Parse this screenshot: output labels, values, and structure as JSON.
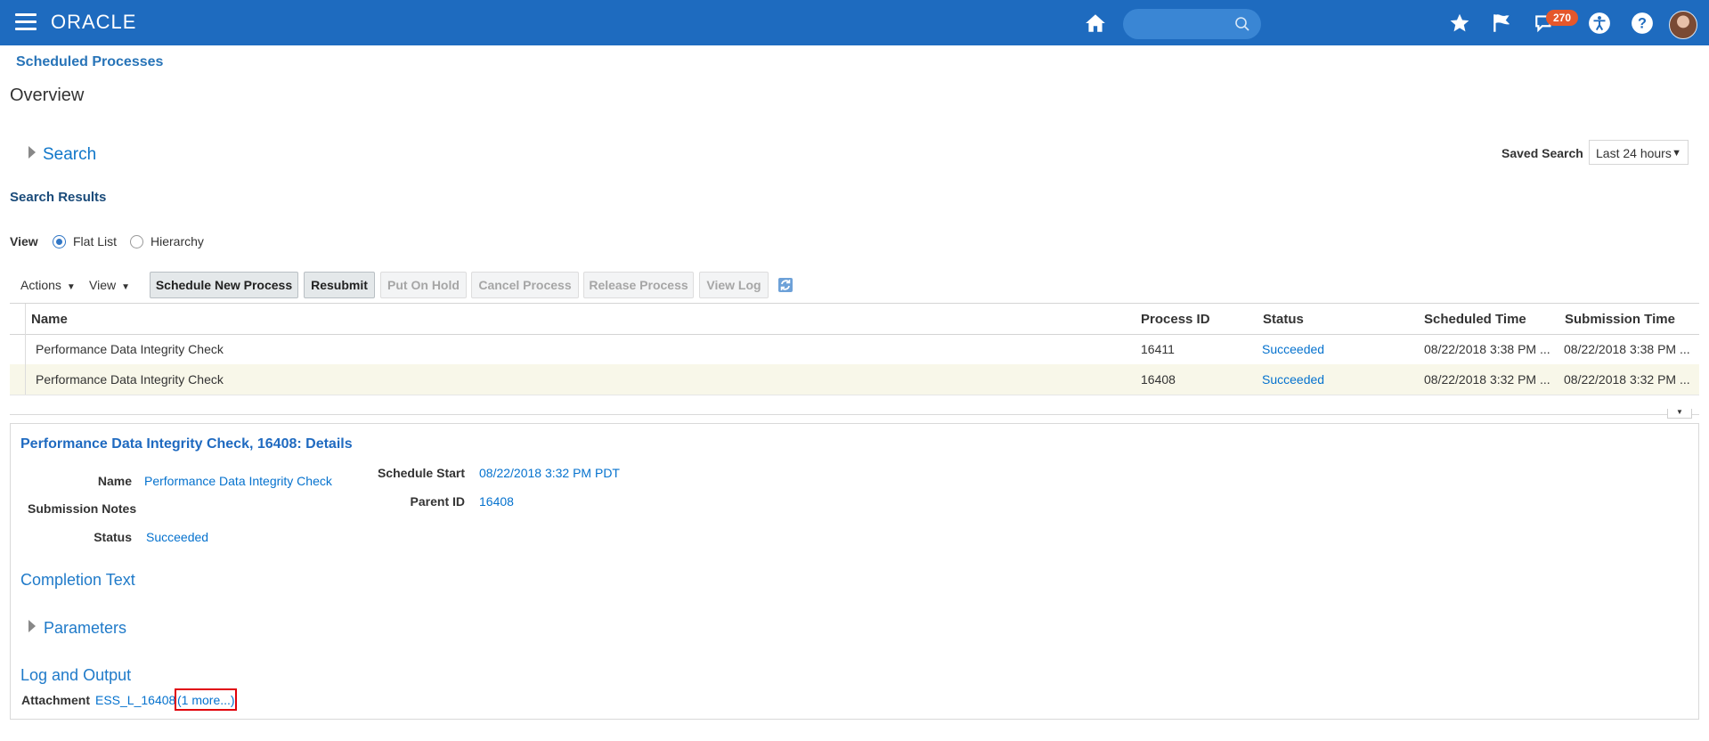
{
  "header": {
    "logo_text": "ORACLE",
    "notification_count": "270",
    "icons": [
      "menu-icon",
      "home-icon",
      "search-icon",
      "star-icon",
      "flag-icon",
      "notification-icon",
      "accessibility-icon",
      "help-icon",
      "avatar"
    ],
    "colors": {
      "bar": "#1e6bbf",
      "badge": "#e5572b"
    }
  },
  "breadcrumb": "Scheduled Processes",
  "page_title": "Overview",
  "search_section": {
    "label": "Search",
    "saved_search_label": "Saved Search",
    "saved_search_value": "Last 24 hours"
  },
  "results": {
    "title": "Search Results",
    "view_label": "View",
    "view_options": [
      {
        "label": "Flat List",
        "checked": true
      },
      {
        "label": "Hierarchy",
        "checked": false
      }
    ],
    "toolbar": {
      "actions_menu": "Actions",
      "view_menu": "View",
      "buttons": [
        {
          "label": "Schedule New Process",
          "enabled": true
        },
        {
          "label": "Resubmit",
          "enabled": true
        },
        {
          "label": "Put On Hold",
          "enabled": false
        },
        {
          "label": "Cancel Process",
          "enabled": false
        },
        {
          "label": "Release Process",
          "enabled": false
        },
        {
          "label": "View Log",
          "enabled": false
        }
      ],
      "refresh_icon": "refresh-icon"
    },
    "columns": [
      "Name",
      "Process ID",
      "Status",
      "Scheduled Time",
      "Submission Time"
    ],
    "rows": [
      {
        "name": "Performance Data Integrity Check",
        "process_id": "16411",
        "status": "Succeeded",
        "scheduled_time": "08/22/2018 3:38 PM ...",
        "submission_time": "08/22/2018 3:38 PM ...",
        "selected": false
      },
      {
        "name": "Performance Data Integrity Check",
        "process_id": "16408",
        "status": "Succeeded",
        "scheduled_time": "08/22/2018 3:32 PM ...",
        "submission_time": "08/22/2018 3:32 PM ...",
        "selected": true
      }
    ]
  },
  "details": {
    "title": "Performance Data Integrity Check, 16408: Details",
    "name_label": "Name",
    "name_value": "Performance Data Integrity Check",
    "notes_label": "Submission Notes",
    "status_label": "Status",
    "status_value": "Succeeded",
    "schedule_start_label": "Schedule Start",
    "schedule_start_value": "08/22/2018 3:32 PM PDT",
    "parent_id_label": "Parent ID",
    "parent_id_value": "16408",
    "completion_text_heading": "Completion Text",
    "parameters_heading": "Parameters",
    "log_output_heading": "Log and Output",
    "attachment_label": "Attachment",
    "attachment_value": "ESS_L_16408",
    "more_link": "(1 more...)",
    "highlight_color": "#e0000a"
  }
}
